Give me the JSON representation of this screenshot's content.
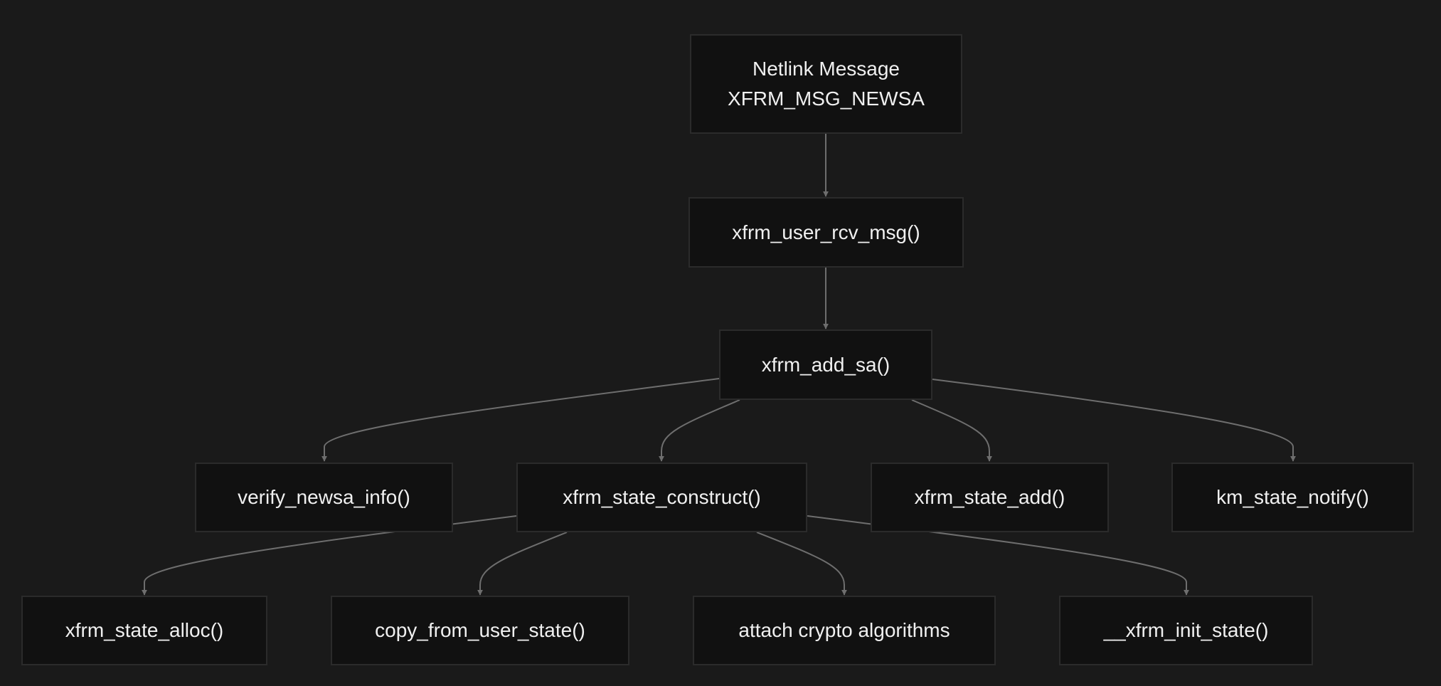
{
  "diagram": {
    "nodes": {
      "netlink": {
        "line1": "Netlink Message",
        "line2": "XFRM_MSG_NEWSA"
      },
      "rcv": {
        "label": "xfrm_user_rcv_msg()"
      },
      "add_sa": {
        "label": "xfrm_add_sa()"
      },
      "verify": {
        "label": "verify_newsa_info()"
      },
      "construct": {
        "label": "xfrm_state_construct()"
      },
      "state_add": {
        "label": "xfrm_state_add()"
      },
      "notify": {
        "label": "km_state_notify()"
      },
      "alloc": {
        "label": "xfrm_state_alloc()"
      },
      "copy": {
        "label": "copy_from_user_state()"
      },
      "crypto": {
        "label": "attach crypto algorithms"
      },
      "init": {
        "label": "__xfrm_init_state()"
      }
    },
    "edges": [
      {
        "from": "netlink",
        "to": "rcv"
      },
      {
        "from": "rcv",
        "to": "add_sa"
      },
      {
        "from": "add_sa",
        "to": "verify"
      },
      {
        "from": "add_sa",
        "to": "construct"
      },
      {
        "from": "add_sa",
        "to": "state_add"
      },
      {
        "from": "add_sa",
        "to": "notify"
      },
      {
        "from": "construct",
        "to": "alloc"
      },
      {
        "from": "construct",
        "to": "copy"
      },
      {
        "from": "construct",
        "to": "crypto"
      },
      {
        "from": "construct",
        "to": "init"
      }
    ],
    "colors": {
      "background": "#1a1a1a",
      "node_fill": "#111111",
      "node_border": "#2b2b2b",
      "edge": "#6e6e6e",
      "text": "#f0f0f0"
    }
  }
}
